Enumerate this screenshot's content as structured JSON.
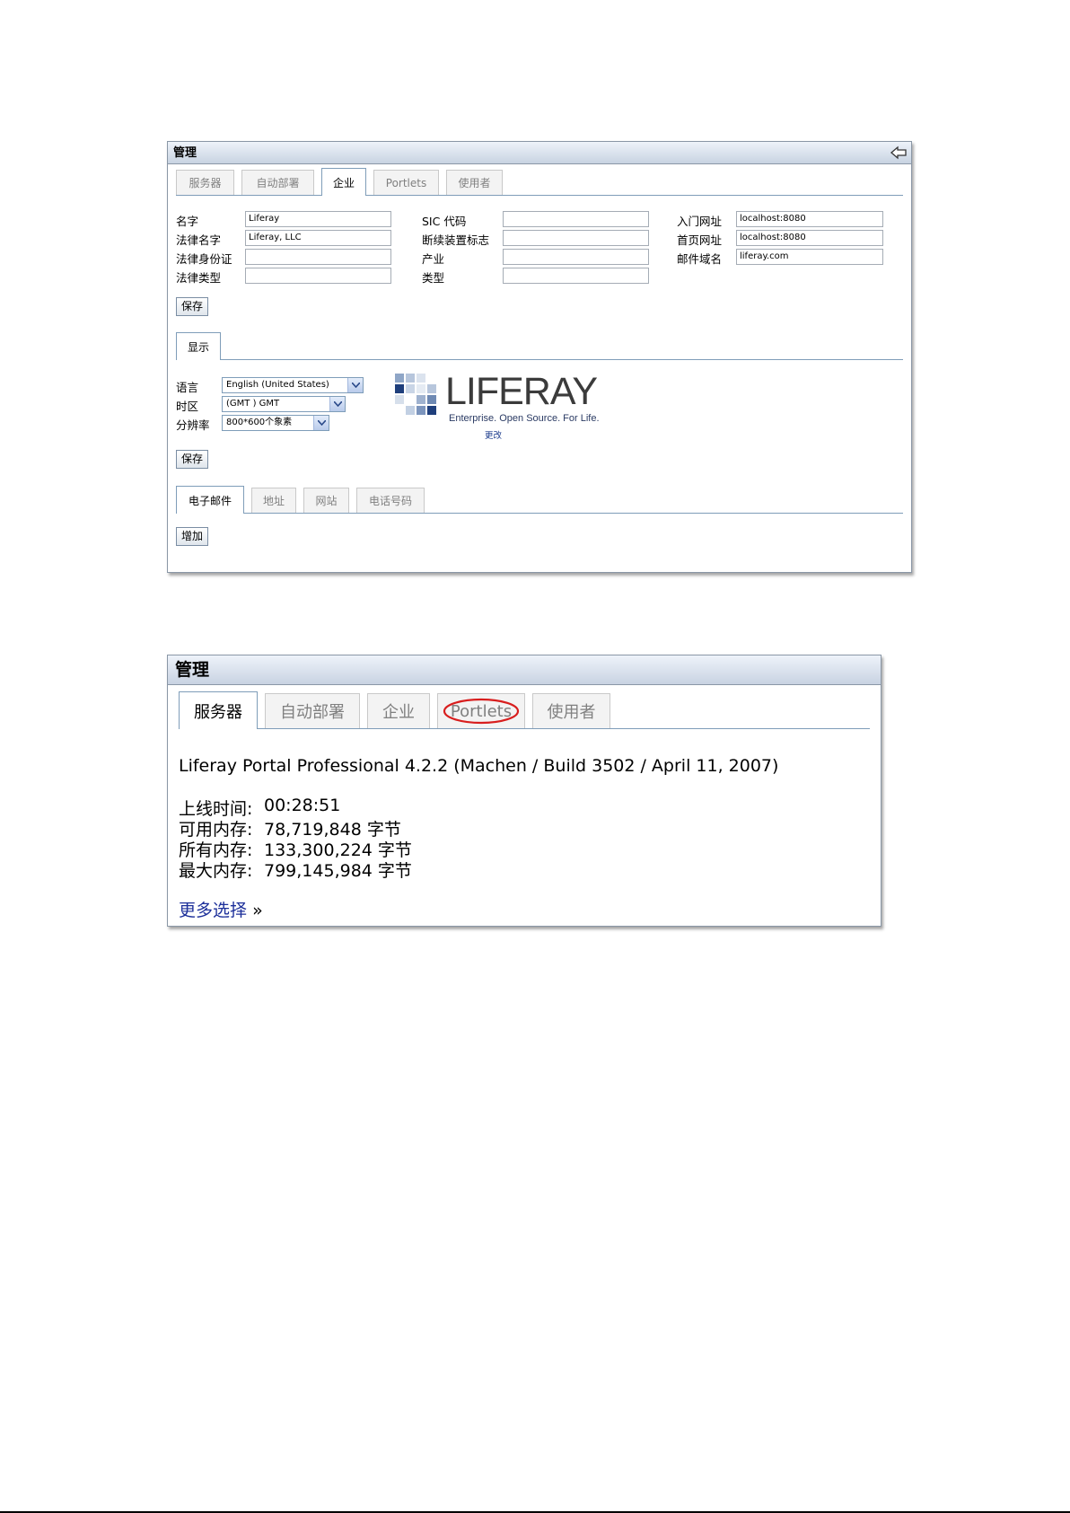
{
  "portlet1": {
    "title": "管理",
    "tabs": [
      "服务器",
      "自动部署",
      "企业",
      "Portlets",
      "使用者"
    ],
    "active_tab": "企业",
    "fields_col1": [
      {
        "label": "名字",
        "value": "Liferay"
      },
      {
        "label": "法律名字",
        "value": "Liferay, LLC"
      },
      {
        "label": "法律身份证",
        "value": ""
      },
      {
        "label": "法律类型",
        "value": ""
      }
    ],
    "fields_col2": [
      {
        "label": "SIC 代码",
        "value": ""
      },
      {
        "label": "断续装置标志",
        "value": ""
      },
      {
        "label": "产业",
        "value": ""
      },
      {
        "label": "类型",
        "value": ""
      }
    ],
    "fields_col3": [
      {
        "label": "入门网址",
        "value": "localhost:8080"
      },
      {
        "label": "首页网址",
        "value": "localhost:8080"
      },
      {
        "label": "邮件域名",
        "value": "liferay.com"
      }
    ],
    "save_label": "保存",
    "display_tab": "显示",
    "display_fields": [
      {
        "label": "语言",
        "value": "English (United States)"
      },
      {
        "label": "时区",
        "value": "(GMT ) GMT"
      },
      {
        "label": "分辨率",
        "value": "800*600个象素"
      }
    ],
    "logo": {
      "name": "LIFERAY",
      "tagline": "Enterprise. Open Source. For Life.",
      "change_label": "更改"
    },
    "save2_label": "保存",
    "contact_tabs": [
      "电子邮件",
      "地址",
      "网站",
      "电话号码"
    ],
    "add_label": "增加"
  },
  "portlet2": {
    "title": "管理",
    "tabs": [
      "服务器",
      "自动部署",
      "企业",
      "Portlets",
      "使用者"
    ],
    "active_tab": "服务器",
    "highlighted_tab": "Portlets",
    "version": "Liferay Portal Professional 4.2.2 (Machen / Build 3502 / April 11, 2007)",
    "stats": [
      {
        "label": "上线时间:",
        "value": "00:28:51"
      },
      {
        "label": "可用内存:",
        "value": "78,719,848 字节"
      },
      {
        "label": "所有内存:",
        "value": "133,300,224 字节"
      },
      {
        "label": "最大内存:",
        "value": "799,145,984 字节"
      }
    ],
    "more_label": "更多选择",
    "more_suffix": "»"
  },
  "colors": {
    "tab_border": "#7f9db9",
    "link": "#1c2f9a",
    "highlight_circle": "#d81e1e"
  }
}
